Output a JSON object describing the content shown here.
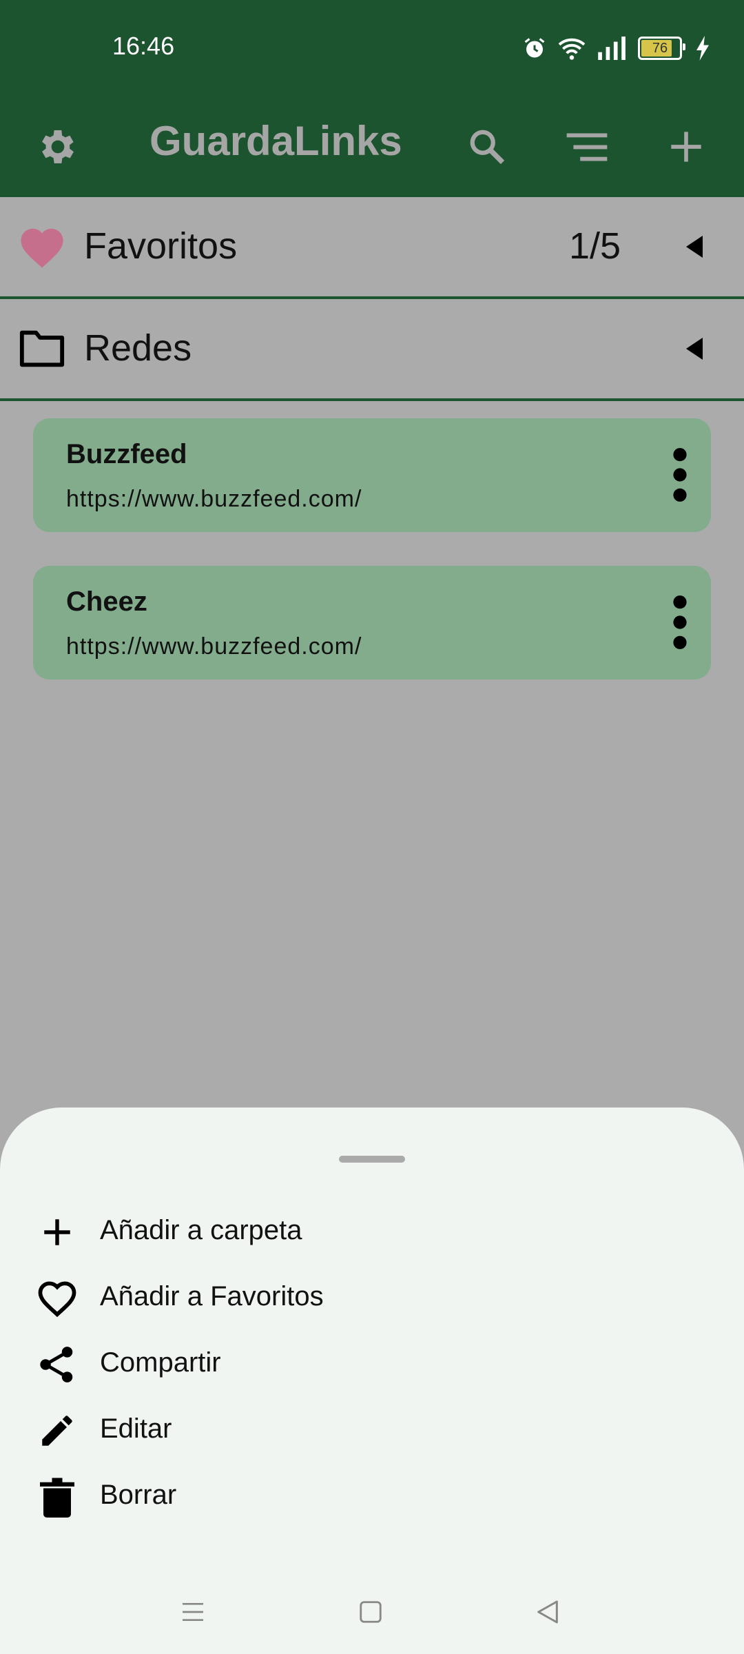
{
  "status_bar": {
    "time": "16:46",
    "battery": "76"
  },
  "app_bar": {
    "title": "GuardaLinks"
  },
  "groups": [
    {
      "label": "Favoritos",
      "count": "1/5",
      "icon": "heart-icon"
    },
    {
      "label": "Redes",
      "icon": "folder-icon"
    }
  ],
  "links": [
    {
      "title": "Buzzfeed",
      "url": "https://www.buzzfeed.com/"
    },
    {
      "title": "Cheez",
      "url": "https://www.buzzfeed.com/"
    }
  ],
  "sheet": {
    "items": [
      {
        "label": "Añadir a carpeta",
        "icon": "plus-icon"
      },
      {
        "label": "Añadir a Favoritos",
        "icon": "heart-outline-icon"
      },
      {
        "label": "Compartir",
        "icon": "share-icon"
      },
      {
        "label": "Editar",
        "icon": "pencil-icon"
      },
      {
        "label": "Borrar",
        "icon": "trash-icon"
      }
    ]
  },
  "colors": {
    "app_bar": "#1c542f",
    "card": "#82ac8c",
    "scrim": "#ababab",
    "heart": "#c66f8c",
    "sheet": "#f1f5f2"
  }
}
